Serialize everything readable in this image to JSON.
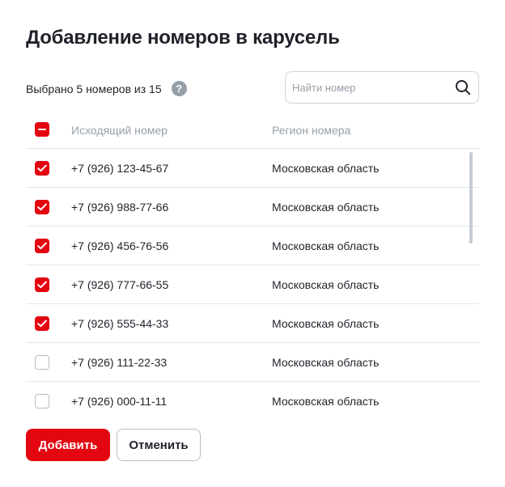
{
  "dialog": {
    "title": "Добавление номеров в карусель",
    "summary": "Выбрано 5 номеров из 15",
    "help_icon": "?"
  },
  "search": {
    "placeholder": "Найти номер",
    "value": "",
    "icon": "search-icon"
  },
  "table": {
    "header": {
      "select_all_state": "indeterminate",
      "col_number": "Исходящий номер",
      "col_region": "Регион номера"
    },
    "rows": [
      {
        "number": "+7 (926) 123-45-67",
        "region": "Московская область",
        "checked": true
      },
      {
        "number": "+7 (926) 988-77-66",
        "region": "Московская область",
        "checked": true
      },
      {
        "number": "+7 (926) 456-76-56",
        "region": "Московская область",
        "checked": true
      },
      {
        "number": "+7 (926) 777-66-55",
        "region": "Московская область",
        "checked": true
      },
      {
        "number": "+7 (926) 555-44-33",
        "region": "Московская область",
        "checked": true
      },
      {
        "number": "+7 (926) 111-22-33",
        "region": "Московская область",
        "checked": false
      },
      {
        "number": "+7 (926) 000-11-11",
        "region": "Московская область",
        "checked": false
      }
    ]
  },
  "actions": {
    "add_label": "Добавить",
    "cancel_label": "Отменить"
  },
  "colors": {
    "accent": "#e30611",
    "text": "#1f2229",
    "muted": "#969fa8",
    "divider": "#e2e5eb"
  }
}
